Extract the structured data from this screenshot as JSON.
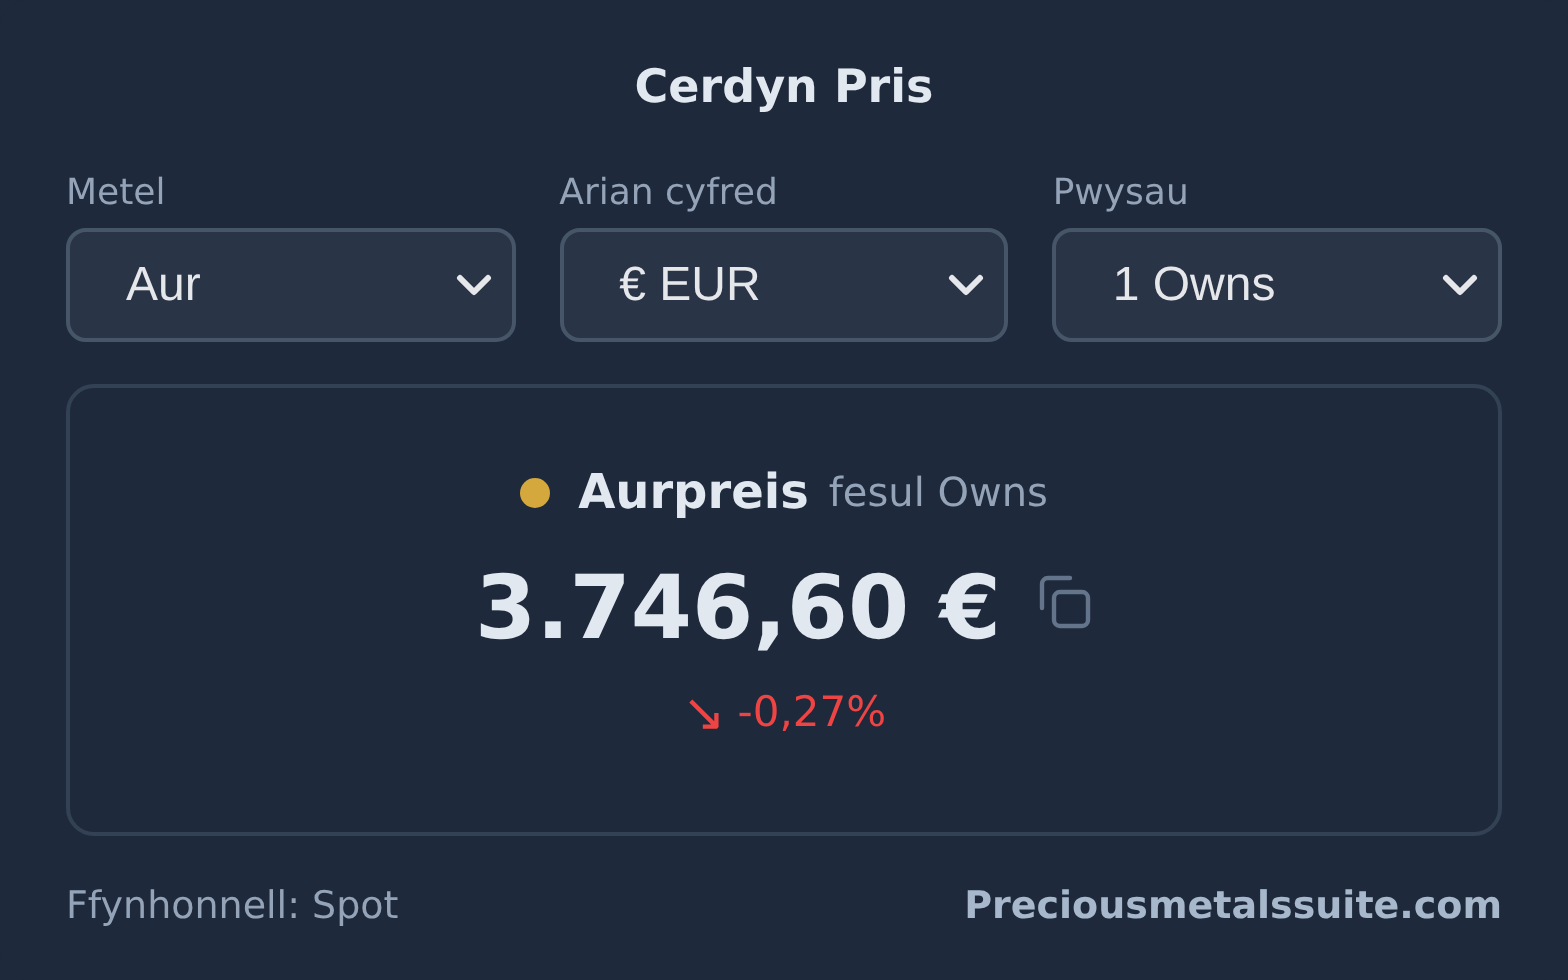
{
  "title": "Cerdyn Pris",
  "selectors": [
    {
      "label": "Metel",
      "value": "Aur"
    },
    {
      "label": "Arian cyfred",
      "value": "€ EUR"
    },
    {
      "label": "Pwysau",
      "value": "1 Owns"
    }
  ],
  "price_card": {
    "metal": {
      "name": "Aurpreis",
      "color": "#d4a83c"
    },
    "unit": "fesul Owns",
    "price": "3.746,60 €",
    "change": {
      "kind": "down",
      "arrow": "↘",
      "value": "-0,27%"
    }
  },
  "footer": {
    "source": "Ffynhonnell: Spot",
    "link": "Preciousmetalssuite.com"
  }
}
